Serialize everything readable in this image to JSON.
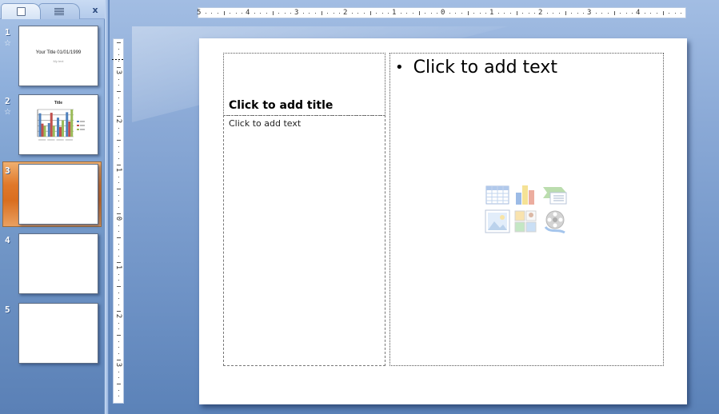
{
  "panel": {
    "tabs": [
      {
        "label": "Slides",
        "icon": "slide-icon",
        "active": true
      },
      {
        "label": "Outline",
        "icon": "outline-icon",
        "active": false
      }
    ],
    "close_label": "x"
  },
  "thumbnails": [
    {
      "number": "1",
      "has_transition": true,
      "transition_icon": "☆",
      "title": "Your Title 01/01/1999",
      "subtitle": "My text",
      "selected": false
    },
    {
      "number": "2",
      "has_transition": true,
      "transition_icon": "☆",
      "title": "Title",
      "chart": true,
      "selected": false
    },
    {
      "number": "3",
      "has_transition": false,
      "selected": true
    },
    {
      "number": "4",
      "has_transition": false,
      "selected": false
    },
    {
      "number": "5",
      "has_transition": false,
      "selected": false
    }
  ],
  "thumb2_chart": {
    "type": "bar",
    "series": [
      {
        "name": "Series 1",
        "color": "#4f81bd",
        "values": [
          4.3,
          2.5,
          3.5,
          4.5
        ]
      },
      {
        "name": "Series 2",
        "color": "#c0504d",
        "values": [
          2.4,
          4.4,
          1.8,
          2.8
        ]
      },
      {
        "name": "Series 3",
        "color": "#9bbb59",
        "values": [
          2,
          2,
          3,
          5
        ]
      }
    ],
    "ymax": 5
  },
  "ruler": {
    "horizontal_labels": [
      "5",
      "4",
      "3",
      "2",
      "1",
      "0",
      "1",
      "2",
      "3",
      "4"
    ],
    "vertical_labels": [
      "3",
      "2",
      "1",
      "0",
      "1",
      "2",
      "3"
    ]
  },
  "slide": {
    "title_placeholder": "Click to add title",
    "text_placeholder": "Click to add text",
    "content_bullet": "•",
    "content_placeholder": "Click to add text",
    "insert_icons": [
      "insert-table",
      "insert-chart",
      "insert-smartart",
      "insert-picture",
      "insert-clip-art",
      "insert-media"
    ]
  },
  "colors": {
    "selection_orange": "#e0782a",
    "panel_blue": "#7398c8"
  }
}
